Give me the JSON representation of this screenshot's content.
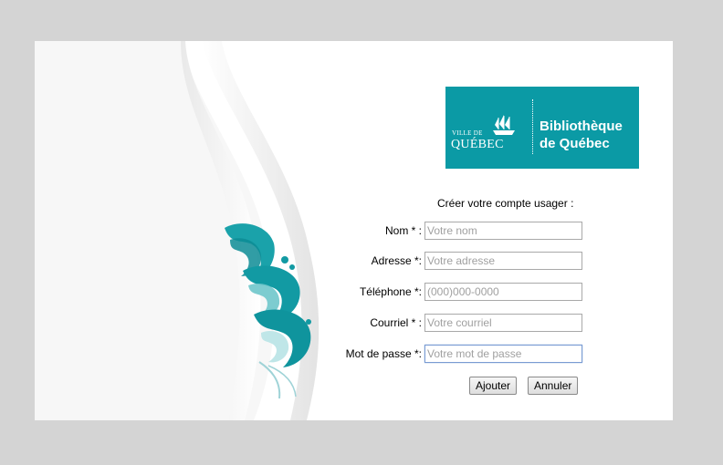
{
  "logo": {
    "ville": "VILLE DE",
    "quebec": "QUÉBEC",
    "library_line1": "Bibliothèque",
    "library_line2": "de Québec",
    "brand_color": "#0b9aa5"
  },
  "form": {
    "title": "Créer votre compte usager :",
    "fields": [
      {
        "label": "Nom * :",
        "placeholder": "Votre nom",
        "value": ""
      },
      {
        "label": "Adresse *:",
        "placeholder": "Votre adresse",
        "value": ""
      },
      {
        "label": "Téléphone *:",
        "placeholder": "(000)000-0000",
        "value": ""
      },
      {
        "label": "Courriel * :",
        "placeholder": "Votre courriel",
        "value": ""
      },
      {
        "label": "Mot de passe *:",
        "placeholder": "Votre mot de passe",
        "value": ""
      }
    ],
    "submit_label": "Ajouter",
    "cancel_label": "Annuler"
  }
}
